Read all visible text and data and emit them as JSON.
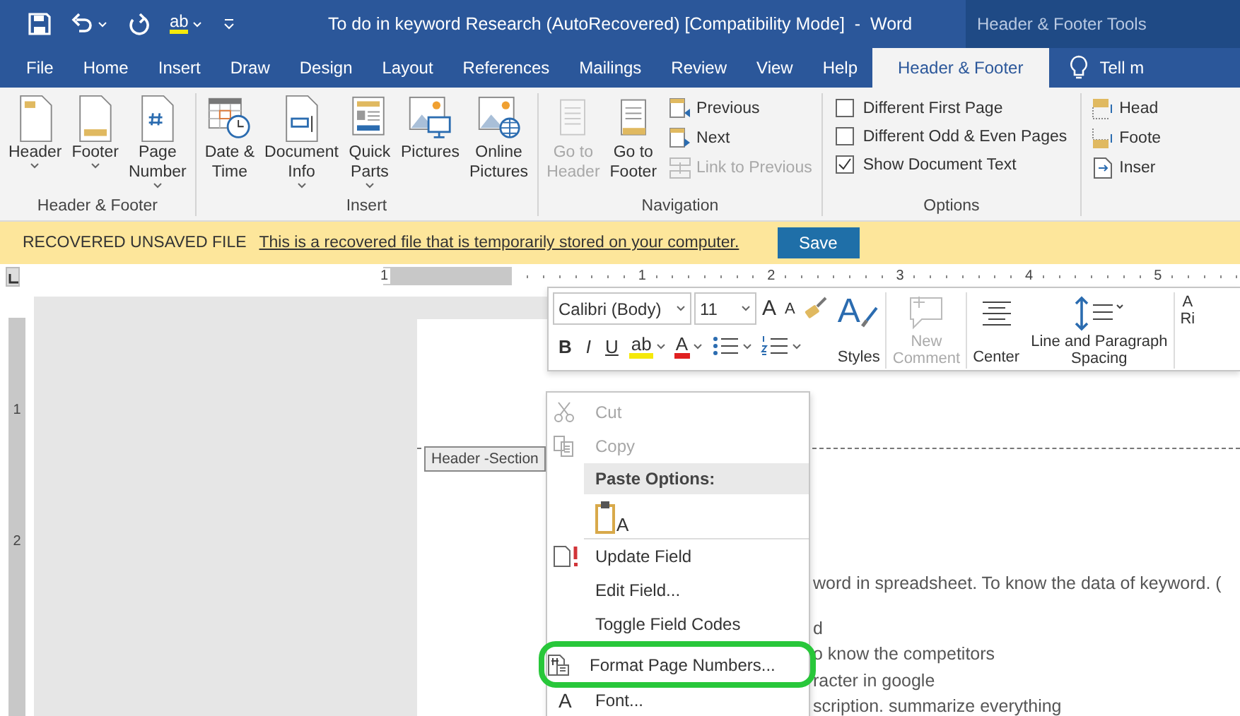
{
  "title_bar": {
    "title": "To do in keyword Research (AutoRecovered) [Compatibility Mode]  -  Word",
    "context_group": "Header & Footer Tools",
    "spelling_glyph": "ab"
  },
  "tabs": [
    {
      "label": "File",
      "selected": false
    },
    {
      "label": "Home",
      "selected": false
    },
    {
      "label": "Insert",
      "selected": false
    },
    {
      "label": "Draw",
      "selected": false
    },
    {
      "label": "Design",
      "selected": false
    },
    {
      "label": "Layout",
      "selected": false
    },
    {
      "label": "References",
      "selected": false
    },
    {
      "label": "Mailings",
      "selected": false
    },
    {
      "label": "Review",
      "selected": false
    },
    {
      "label": "View",
      "selected": false
    },
    {
      "label": "Help",
      "selected": false
    },
    {
      "label": "Header & Footer",
      "selected": true
    }
  ],
  "tell_me": "Tell m",
  "ribbon_groups": [
    {
      "name": "Header & Footer",
      "items": [
        {
          "kind": "large",
          "label": "Header",
          "dropdown": true,
          "disabled": false
        },
        {
          "kind": "large",
          "label": "Footer",
          "dropdown": true,
          "disabled": false
        },
        {
          "kind": "large",
          "label": "Page\nNumber",
          "dropdown": true,
          "disabled": false
        }
      ]
    },
    {
      "name": "Insert",
      "items": [
        {
          "kind": "large",
          "label": "Date &\nTime",
          "dropdown": false,
          "disabled": false
        },
        {
          "kind": "large",
          "label": "Document\nInfo",
          "dropdown": true,
          "disabled": false
        },
        {
          "kind": "large",
          "label": "Quick\nParts",
          "dropdown": true,
          "disabled": false
        },
        {
          "kind": "large",
          "label": "Pictures",
          "dropdown": false,
          "disabled": false
        },
        {
          "kind": "large",
          "label": "Online\nPictures",
          "dropdown": false,
          "disabled": false
        }
      ]
    },
    {
      "name": "Navigation",
      "items": [
        {
          "kind": "large",
          "label": "Go to\nHeader",
          "dropdown": false,
          "disabled": true
        },
        {
          "kind": "large",
          "label": "Go to\nFooter",
          "dropdown": false,
          "disabled": false
        },
        {
          "kind": "small",
          "label": "Previous",
          "disabled": false
        },
        {
          "kind": "small",
          "label": "Next",
          "disabled": false
        },
        {
          "kind": "small",
          "label": "Link to Previous",
          "disabled": true
        }
      ]
    },
    {
      "name": "Options",
      "items": [
        {
          "kind": "check",
          "label": "Different First Page",
          "checked": false
        },
        {
          "kind": "check",
          "label": "Different Odd & Even Pages",
          "checked": false
        },
        {
          "kind": "check",
          "label": "Show Document Text",
          "checked": true
        }
      ]
    },
    {
      "items": [
        {
          "kind": "small",
          "label": "Head",
          "disabled": false
        },
        {
          "kind": "small",
          "label": "Foote",
          "disabled": false
        },
        {
          "kind": "small",
          "label": "Inser",
          "disabled": false
        }
      ]
    }
  ],
  "message_bar": {
    "label": "RECOVERED UNSAVED FILE",
    "message": "This is a recovered file that is temporarily stored on your computer.",
    "button": "Save"
  },
  "ruler": {
    "h_numbers": [
      "1",
      "1",
      "2",
      "3",
      "4",
      "5"
    ],
    "v_numbers": [
      "1",
      "2"
    ]
  },
  "document": {
    "header_tag": "Header -Section",
    "body_lines": [
      "word in spreadsheet. To know the data of keyword. (",
      "d",
      "o know the competitors",
      "racter in google",
      "scription. summarize everything"
    ]
  },
  "mini_toolbar": {
    "font": "Calibri (Body)",
    "size": "11",
    "grow_glyph": "A",
    "shrink_glyph": "A",
    "format_buttons": [
      {
        "kind": "bold",
        "label": "B"
      },
      {
        "kind": "italic",
        "label": "I"
      },
      {
        "kind": "underline",
        "label": "U"
      },
      {
        "kind": "highlight",
        "label": "ab"
      },
      {
        "kind": "font-color",
        "label": "A"
      },
      {
        "kind": "bullets"
      },
      {
        "kind": "numbering"
      }
    ],
    "big_buttons": [
      {
        "label": "Styles",
        "glyph": "A",
        "disabled": false
      },
      {
        "label": "New\nComment",
        "disabled": true
      },
      {
        "label": "Center",
        "disabled": false
      },
      {
        "label": "Line and Paragraph\nSpacing",
        "disabled": false
      },
      {
        "label": "A\nRi",
        "disabled": false
      }
    ]
  },
  "context_menu": {
    "items": [
      {
        "kind": "item",
        "label": "Cut",
        "disabled": true,
        "circled": false
      },
      {
        "kind": "item",
        "label": "Copy",
        "disabled": true,
        "circled": false
      },
      {
        "kind": "header",
        "label": "Paste Options:"
      },
      {
        "kind": "paste",
        "glyph": "A"
      },
      {
        "kind": "item",
        "label": "Update Field",
        "disabled": false,
        "circled": false
      },
      {
        "kind": "item",
        "label": "Edit Field...",
        "disabled": false,
        "circled": false
      },
      {
        "kind": "item",
        "label": "Toggle Field Codes",
        "disabled": false,
        "circled": false
      },
      {
        "kind": "item",
        "label": "Format Page Numbers...",
        "disabled": false,
        "circled": true
      },
      {
        "kind": "item",
        "label": "Font...",
        "glyph": "A",
        "disabled": false,
        "circled": false
      }
    ]
  }
}
